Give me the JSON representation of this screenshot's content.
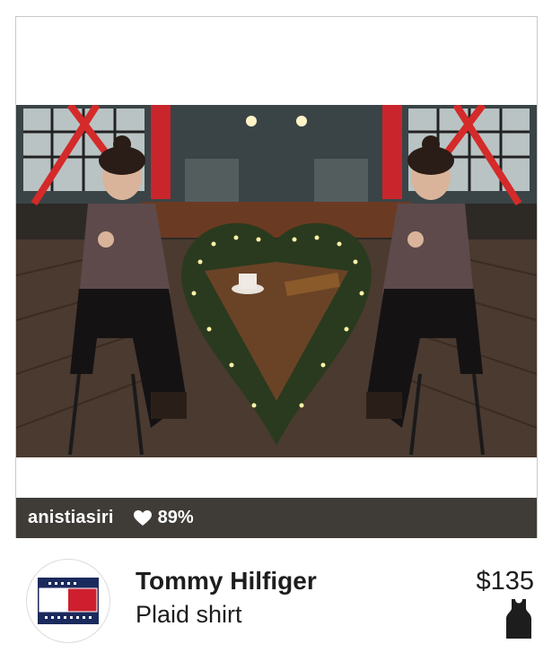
{
  "post": {
    "username": "anistiasiri",
    "likes_percent": "89%"
  },
  "product": {
    "brand": "Tommy Hilfiger",
    "name": "Plaid shirt",
    "price": "$135",
    "category_icon": "tank-top-icon",
    "brand_logo": "tommy-hilfiger-logo"
  },
  "colors": {
    "bar": "#3f3c37",
    "logo_navy": "#1b2a5c",
    "logo_red": "#cf1f2e"
  }
}
